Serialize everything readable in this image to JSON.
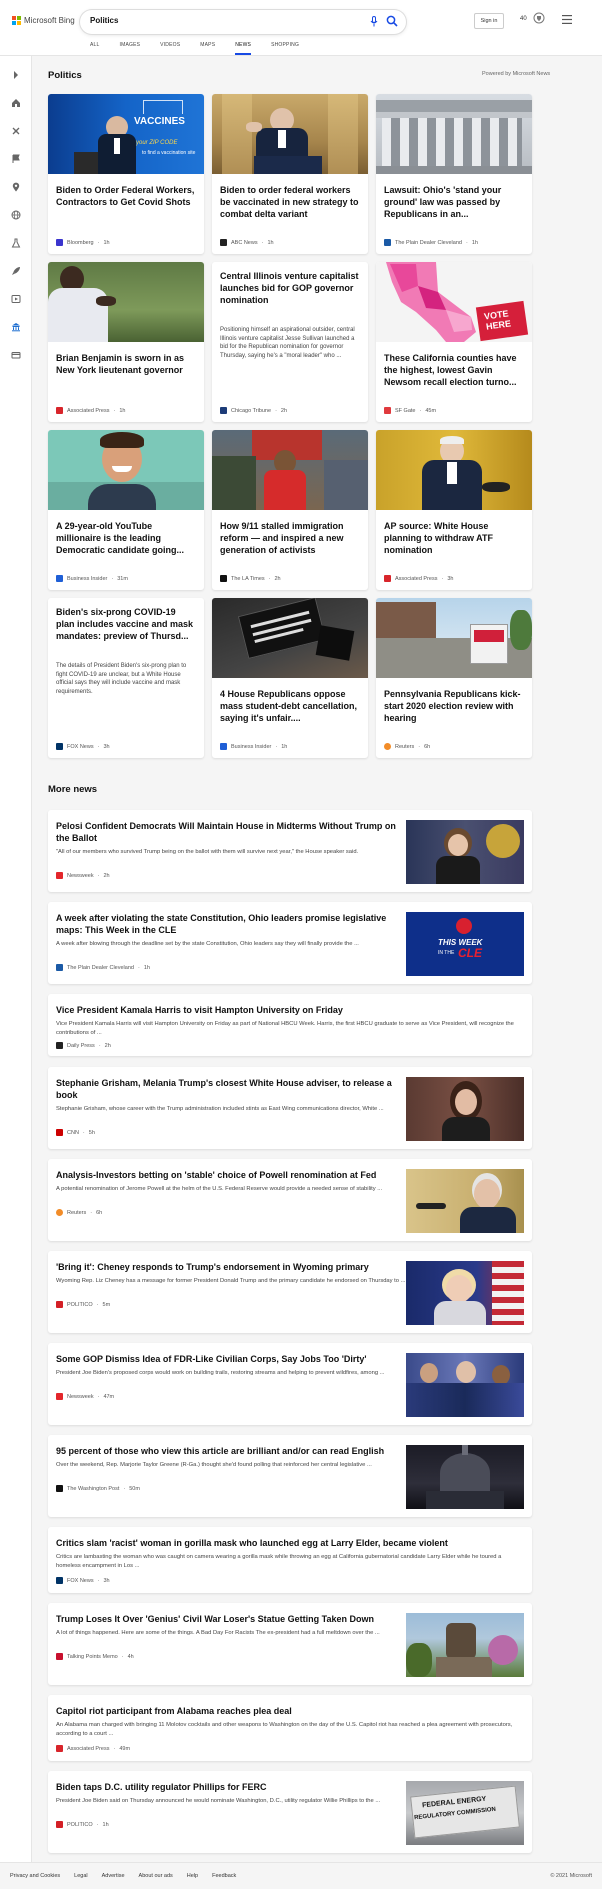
{
  "header": {
    "brand": "Microsoft Bing",
    "search_value": "Politics",
    "signin_label": "Sign in",
    "rewards_points": "40",
    "tabs": [
      "ALL",
      "IMAGES",
      "VIDEOS",
      "MAPS",
      "NEWS",
      "SHOPPING"
    ],
    "active_tab": "NEWS"
  },
  "colors": {
    "accent": "#174ae4",
    "ms_red": "#f25022",
    "ms_green": "#7fba00",
    "ms_blue": "#00a4ef",
    "ms_yellow": "#ffb900"
  },
  "politics": {
    "title": "Politics",
    "powered_by": "Powered by Microsoft News",
    "cards": [
      {
        "title": "Biden to Order Federal Workers, Contractors to Get Covid Shots",
        "source": "Bloomberg",
        "time": "1h",
        "icon_color": "#3b35ce"
      },
      {
        "title": "Biden to order federal workers be vaccinated in new strategy to combat delta variant",
        "source": "ABC News",
        "time": "1h",
        "icon_color": "#222"
      },
      {
        "title": "Lawsuit: Ohio's 'stand your ground' law was passed by Republicans in an...",
        "source": "The Plain Dealer Cleveland",
        "time": "1h",
        "icon_color": "#1b5aa6"
      },
      {
        "title": "Brian Benjamin is sworn in as New York lieutenant governor",
        "source": "Associated Press",
        "time": "1h",
        "icon_color": "#d8252b"
      },
      {
        "title": "Central Illinois venture capitalist launches bid for GOP governor nomination",
        "desc": "Positioning himself an aspirational outsider, central Illinois venture capitalist Jesse Sullivan launched a bid for the Republican nomination for governor Thursday, saying he's a \"moral leader\" who ...",
        "source": "Chicago Tribune",
        "time": "2h",
        "icon_color": "#1d3c78"
      },
      {
        "title": "These California counties have the highest, lowest Gavin Newsom recall election turno...",
        "source": "SF Gate",
        "time": "45m",
        "icon_color": "#e03a3e"
      },
      {
        "title": "A 29-year-old YouTube millionaire is the leading Democratic candidate going...",
        "source": "Business Insider",
        "time": "31m",
        "icon_color": "#1f5fd6"
      },
      {
        "title": "How 9/11 stalled immigration reform — and inspired a new generation of activists",
        "source": "The LA Times",
        "time": "2h",
        "icon_color": "#111"
      },
      {
        "title": "AP source: White House planning to withdraw ATF nomination",
        "source": "Associated Press",
        "time": "3h",
        "icon_color": "#d8252b"
      },
      {
        "title": "Biden's six-prong COVID-19 plan includes vaccine and mask mandates: preview of Thursd...",
        "desc": "The details of President Biden's six-prong plan to fight COVID-19 are unclear, but a White House official says they will include vaccine and mask requirements.",
        "source": "FOX News",
        "time": "3h",
        "icon_color": "#003366"
      },
      {
        "title": "4 House Republicans oppose mass student-debt cancellation, saying it's unfair....",
        "source": "Business Insider",
        "time": "1h",
        "icon_color": "#1f5fd6"
      },
      {
        "title": "Pennsylvania Republicans kick-start 2020 election review with hearing",
        "source": "Reuters",
        "time": "6h",
        "icon_color": "#f28c28"
      }
    ]
  },
  "more_news": {
    "title": "More news",
    "items": [
      {
        "title": "Pelosi Confident Democrats Will Maintain House in Midterms Without Trump on the Ballot",
        "desc": "\"All of our members who survived Trump being on the ballot with them will survive next year,\" the House speaker said.",
        "source": "Newsweek",
        "time": "2h",
        "icon_color": "#e3262b"
      },
      {
        "title": "A week after violating the state Constitution, Ohio leaders promise legislative maps: This Week in the CLE",
        "desc": "A week after blowing through the deadline set by the state Constitution, Ohio leaders say they will finally provide the ...",
        "source": "The Plain Dealer Cleveland",
        "time": "1h",
        "icon_color": "#1b5aa6",
        "image_text_1": "THIS WEEK",
        "image_text_2": "IN THE",
        "image_text_3": "CLE"
      },
      {
        "title": "Vice President Kamala Harris to visit Hampton University on Friday",
        "desc": "Vice President Kamala Harris will visit Hampton University on Friday as part of National HBCU Week. Harris, the first HBCU graduate to serve as Vice President, will recognize the contributions of ...",
        "source": "Daily Press",
        "time": "2h",
        "icon_color": "#222"
      },
      {
        "title": "Stephanie Grisham, Melania Trump's closest White House adviser, to release a book",
        "desc": "Stephanie Grisham, whose career with the Trump administration included stints as East Wing communications director, White ...",
        "source": "CNN",
        "time": "5h",
        "icon_color": "#cc0000"
      },
      {
        "title": "Analysis-Investors betting on 'stable' choice of Powell renomination at Fed",
        "desc": "A potential renomination of Jerome Powell at the helm of the U.S. Federal Reserve would provide a needed sense of stability ...",
        "source": "Reuters",
        "time": "6h",
        "icon_color": "#f28c28"
      },
      {
        "title": "'Bring it': Cheney responds to Trump's endorsement in Wyoming primary",
        "desc": "Wyoming Rep. Liz Cheney has a message for former President Donald Trump and the primary candidate he endorsed on Thursday to ...",
        "source": "POLITICO",
        "time": "5m",
        "icon_color": "#d31f26"
      },
      {
        "title": "Some GOP Dismiss Idea of FDR-Like Civilian Corps, Say Jobs Too 'Dirty'",
        "desc": "President Joe Biden's proposed corps would work on building trails, restoring streams and helping to prevent wildfires, among ...",
        "source": "Newsweek",
        "time": "47m",
        "icon_color": "#e3262b"
      },
      {
        "title": "95 percent of those who view this article are brilliant and/or can read English",
        "desc": "Over the weekend, Rep. Marjorie Taylor Greene (R-Ga.) thought she'd found polling that reinforced her central legislative ...",
        "source": "The Washington Post",
        "time": "50m",
        "icon_color": "#111"
      },
      {
        "title": "Critics slam 'racist' woman in gorilla mask who launched egg at Larry Elder, became violent",
        "desc": "Critics are lambasting the woman who was caught on camera wearing a gorilla mask while throwing an egg at California gubernatorial candidate Larry Elder while he toured a homeless encampment in Los ...",
        "source": "FOX News",
        "time": "3h",
        "icon_color": "#003366"
      },
      {
        "title": "Trump Loses It Over 'Genius' Civil War Loser's Statue Getting Taken Down",
        "desc": "A lot of things happened. Here are some of the things. A Bad Day For Racists The ex-president had a full meltdown over the ...",
        "source": "Talking Points Memo",
        "time": "4h",
        "icon_color": "#c8102e"
      },
      {
        "title": "Capitol riot participant from Alabama reaches plea deal",
        "desc": "An Alabama man charged with bringing 11 Molotov cocktails and other weapons to Washington on the day of the U.S. Capitol riot has reached a plea agreement with prosecutors, according to a court ...",
        "source": "Associated Press",
        "time": "49m",
        "icon_color": "#d8252b"
      },
      {
        "title": "Biden taps D.C. utility regulator Phillips for FERC",
        "desc": "President Joe Biden said on Thursday announced he would nominate Washington, D.C., utility regulator Willie Phillips to the ...",
        "source": "POLITICO",
        "time": "1h",
        "icon_color": "#d31f26",
        "image_text_1": "FEDERAL ENERGY",
        "image_text_2": "REGULATORY COMMISSION"
      }
    ]
  },
  "card_images": {
    "vaccines_banner": "VACCINES",
    "zip_line": "your ZIP CODE",
    "find_line": "to find a vaccination site",
    "vote_1": "VOTE",
    "vote_2": "HERE"
  },
  "footer": {
    "links": [
      "Privacy and Cookies",
      "Legal",
      "Advertise",
      "About our ads",
      "Help",
      "Feedback"
    ],
    "copyright": "© 2021 Microsoft"
  }
}
